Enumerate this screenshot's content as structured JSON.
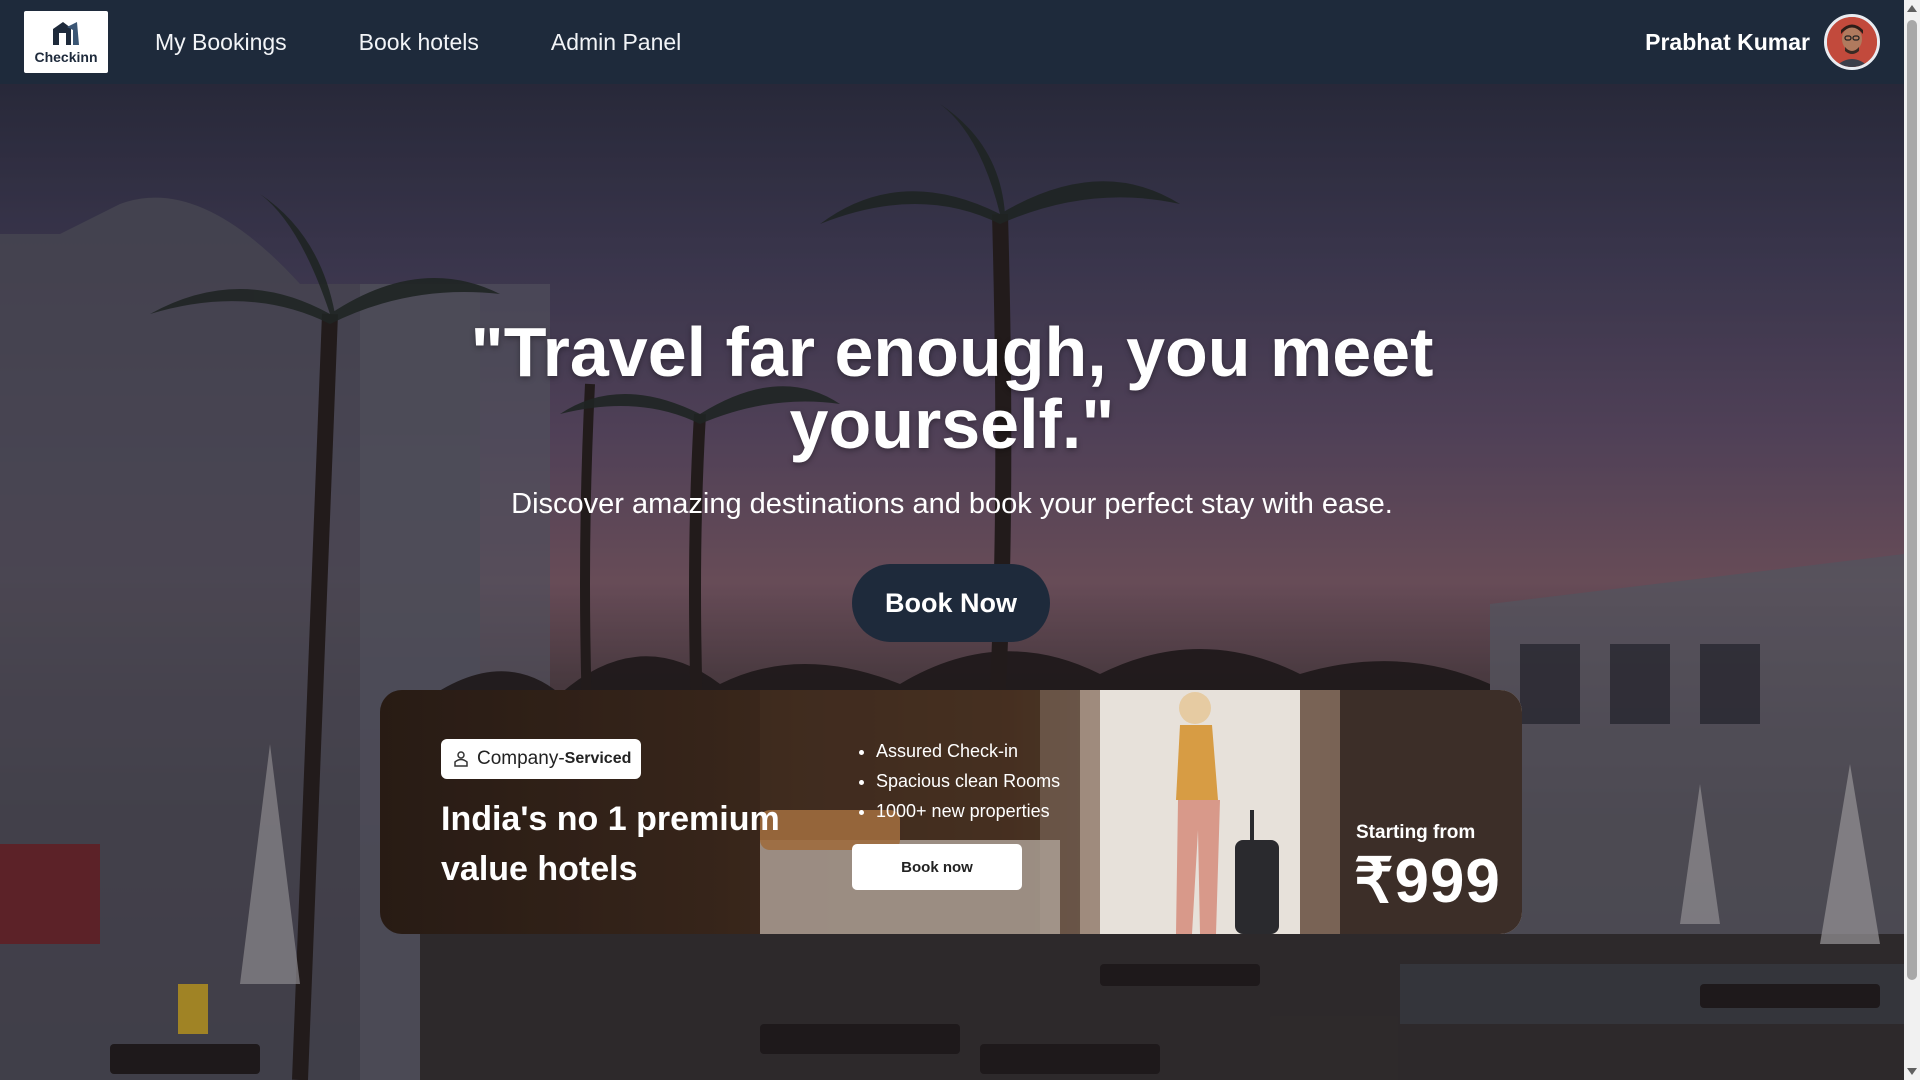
{
  "nav": {
    "logo_text": "Checkinn",
    "links": [
      "My Bookings",
      "Book hotels",
      "Admin Panel"
    ],
    "user_name": "Prabhat Kumar"
  },
  "hero": {
    "title": "\"Travel far enough, you meet yourself.\"",
    "subtitle": "Discover amazing destinations and book your perfect stay with ease.",
    "button_label": "Book Now"
  },
  "promo": {
    "badge_text": "Company-",
    "badge_strong": "Serviced",
    "title": "India's no 1 premium value hotels",
    "features": [
      "Assured Check-in",
      "Spacious clean Rooms",
      "1000+ new properties"
    ],
    "button_label": "Book now",
    "price_label": "Starting from",
    "price": "₹999"
  },
  "colors": {
    "nav_bg": "#1e2a3b",
    "button_dark": "#1e2a3b",
    "text_light": "#ffffff"
  }
}
